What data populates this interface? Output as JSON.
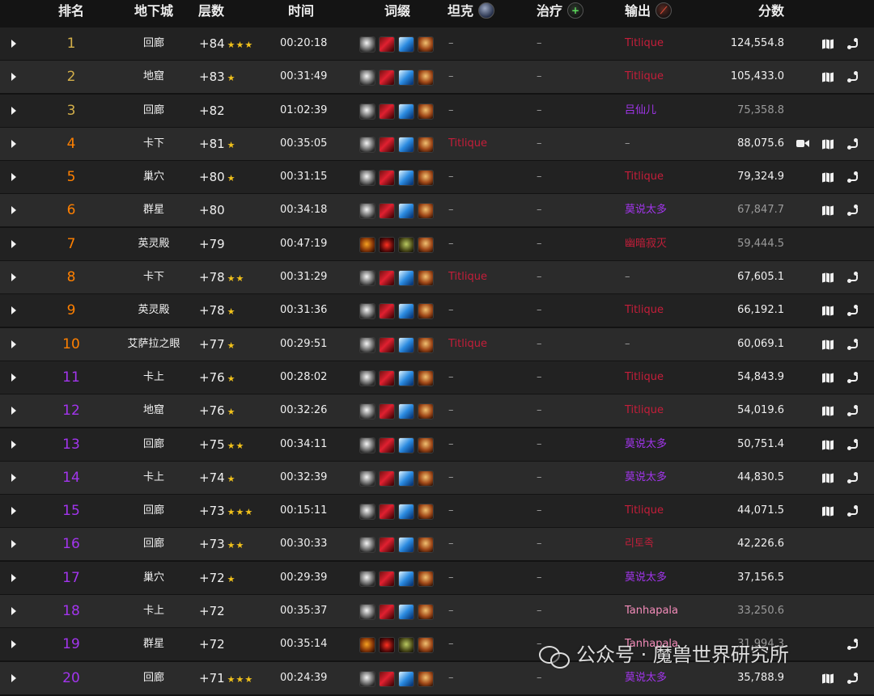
{
  "header": {
    "rank": "排名",
    "dungeon": "地下城",
    "level": "层数",
    "time": "时间",
    "affixes": "词缀",
    "tank": "坦克",
    "healer": "治疗",
    "dps": "输出",
    "score": "分数"
  },
  "colors": {
    "rank_gold": "#d4b04a",
    "rank_orange": "#ff8000",
    "rank_purple": "#a335ee",
    "class_red": "#c41e3a",
    "class_purple": "#a335ee",
    "class_pink": "#f48cba",
    "star": "#f2c21b"
  },
  "rows": [
    {
      "rank": "1",
      "dungeon": "回廊",
      "level": "+84",
      "stars": "★★★",
      "time": "00:20:18",
      "affix": "a",
      "tank": "–",
      "heal": "–",
      "dps": "Titlique",
      "dps_color": "red",
      "score": "124,554.8",
      "video": false,
      "map": true,
      "route": true
    },
    {
      "rank": "2",
      "dungeon": "地窟",
      "level": "+83",
      "stars": "★",
      "time": "00:31:49",
      "affix": "a",
      "tank": "–",
      "heal": "–",
      "dps": "Titlique",
      "dps_color": "red",
      "score": "105,433.0",
      "video": false,
      "map": true,
      "route": true
    },
    {
      "rank": "3",
      "dungeon": "回廊",
      "level": "+82",
      "stars": "",
      "time": "01:02:39",
      "affix": "a",
      "tank": "–",
      "heal": "–",
      "dps": "吕仙儿",
      "dps_color": "purple",
      "score": "75,358.8",
      "dim": true,
      "video": false,
      "map": false,
      "route": false
    },
    {
      "rank": "4",
      "dungeon": "卡下",
      "level": "+81",
      "stars": "★",
      "time": "00:35:05",
      "affix": "a",
      "tank": "Titlique",
      "tank_color": "red",
      "heal": "–",
      "dps": "–",
      "score": "88,075.6",
      "video": true,
      "map": true,
      "route": true
    },
    {
      "rank": "5",
      "dungeon": "巢穴",
      "level": "+80",
      "stars": "★",
      "time": "00:31:15",
      "affix": "a",
      "tank": "–",
      "heal": "–",
      "dps": "Titlique",
      "dps_color": "red",
      "score": "79,324.9",
      "video": false,
      "map": true,
      "route": true
    },
    {
      "rank": "6",
      "dungeon": "群星",
      "level": "+80",
      "stars": "",
      "time": "00:34:18",
      "affix": "a",
      "tank": "–",
      "heal": "–",
      "dps": "莫说太多",
      "dps_color": "purple",
      "score": "67,847.7",
      "dim": true,
      "video": false,
      "map": true,
      "route": true
    },
    {
      "rank": "7",
      "dungeon": "英灵殿",
      "level": "+79",
      "stars": "",
      "time": "00:47:19",
      "affix": "b",
      "tank": "–",
      "heal": "–",
      "dps": "幽暗寂灭",
      "dps_color": "red",
      "score": "59,444.5",
      "dim": true,
      "video": false,
      "map": false,
      "route": false
    },
    {
      "rank": "8",
      "dungeon": "卡下",
      "level": "+78",
      "stars": "★★",
      "time": "00:31:29",
      "affix": "a",
      "tank": "Titlique",
      "tank_color": "red",
      "heal": "–",
      "dps": "–",
      "score": "67,605.1",
      "video": false,
      "map": true,
      "route": true
    },
    {
      "rank": "9",
      "dungeon": "英灵殿",
      "level": "+78",
      "stars": "★",
      "time": "00:31:36",
      "affix": "a",
      "tank": "–",
      "heal": "–",
      "dps": "Titlique",
      "dps_color": "red",
      "score": "66,192.1",
      "video": false,
      "map": true,
      "route": true
    },
    {
      "rank": "10",
      "dungeon": "艾萨拉之眼",
      "level": "+77",
      "stars": "★",
      "time": "00:29:51",
      "affix": "a",
      "tank": "Titlique",
      "tank_color": "red",
      "heal": "–",
      "dps": "–",
      "score": "60,069.1",
      "video": false,
      "map": true,
      "route": true
    },
    {
      "rank": "11",
      "dungeon": "卡上",
      "level": "+76",
      "stars": "★",
      "time": "00:28:02",
      "affix": "a",
      "tank": "–",
      "heal": "–",
      "dps": "Titlique",
      "dps_color": "red",
      "score": "54,843.9",
      "video": false,
      "map": true,
      "route": true
    },
    {
      "rank": "12",
      "dungeon": "地窟",
      "level": "+76",
      "stars": "★",
      "time": "00:32:26",
      "affix": "a",
      "tank": "–",
      "heal": "–",
      "dps": "Titlique",
      "dps_color": "red",
      "score": "54,019.6",
      "video": false,
      "map": true,
      "route": true
    },
    {
      "rank": "13",
      "dungeon": "回廊",
      "level": "+75",
      "stars": "★★",
      "time": "00:34:11",
      "affix": "a",
      "tank": "–",
      "heal": "–",
      "dps": "莫说太多",
      "dps_color": "purple",
      "score": "50,751.4",
      "video": false,
      "map": true,
      "route": true
    },
    {
      "rank": "14",
      "dungeon": "卡上",
      "level": "+74",
      "stars": "★",
      "time": "00:32:39",
      "affix": "a",
      "tank": "–",
      "heal": "–",
      "dps": "莫说太多",
      "dps_color": "purple",
      "score": "44,830.5",
      "video": false,
      "map": true,
      "route": true
    },
    {
      "rank": "15",
      "dungeon": "回廊",
      "level": "+73",
      "stars": "★★★",
      "time": "00:15:11",
      "affix": "a",
      "tank": "–",
      "heal": "–",
      "dps": "Titlique",
      "dps_color": "red",
      "score": "44,071.5",
      "video": false,
      "map": true,
      "route": true
    },
    {
      "rank": "16",
      "dungeon": "回廊",
      "level": "+73",
      "stars": "★★",
      "time": "00:30:33",
      "affix": "a",
      "tank": "–",
      "heal": "–",
      "dps": "리토족",
      "dps_color": "red",
      "score": "42,226.6",
      "video": false,
      "map": false,
      "route": false
    },
    {
      "rank": "17",
      "dungeon": "巢穴",
      "level": "+72",
      "stars": "★",
      "time": "00:29:39",
      "affix": "a",
      "tank": "–",
      "heal": "–",
      "dps": "莫说太多",
      "dps_color": "purple",
      "score": "37,156.5",
      "video": false,
      "map": false,
      "route": false
    },
    {
      "rank": "18",
      "dungeon": "卡上",
      "level": "+72",
      "stars": "",
      "time": "00:35:37",
      "affix": "a",
      "tank": "–",
      "heal": "–",
      "dps": "Tanhapala",
      "dps_color": "pink",
      "score": "33,250.6",
      "dim": true,
      "video": false,
      "map": false,
      "route": false
    },
    {
      "rank": "19",
      "dungeon": "群星",
      "level": "+72",
      "stars": "",
      "time": "00:35:14",
      "affix": "b",
      "tank": "–",
      "heal": "–",
      "dps": "Tanhapala",
      "dps_color": "pink",
      "score": "31,994.3",
      "dim": true,
      "video": false,
      "map": false,
      "route": true
    },
    {
      "rank": "20",
      "dungeon": "回廊",
      "level": "+71",
      "stars": "★★★",
      "time": "00:24:39",
      "affix": "a",
      "tank": "–",
      "heal": "–",
      "dps": "莫说太多",
      "dps_color": "purple",
      "score": "35,788.9",
      "video": false,
      "map": true,
      "route": true
    }
  ],
  "affix_sets": {
    "a": [
      "skull-shield-affix-icon",
      "red-wing-affix-icon",
      "blue-crystal-affix-icon",
      "bronze-beast-affix-icon"
    ],
    "b": [
      "flame-orb-affix-icon",
      "red-demon-affix-icon",
      "green-skull-affix-icon",
      "bronze-beast-affix-icon"
    ]
  },
  "watermark": {
    "text": "公众号 · 魔兽世界研究所",
    "icon": "wechat-icon"
  }
}
